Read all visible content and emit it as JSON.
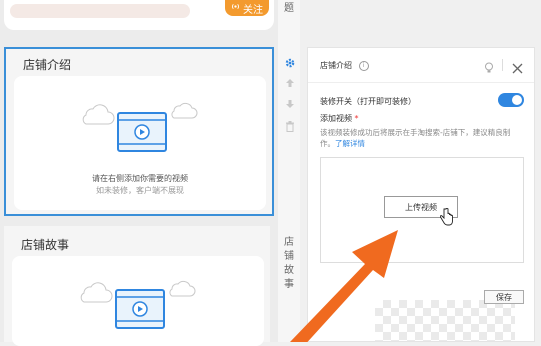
{
  "top_card": {
    "follow_label": "关注"
  },
  "side_tab_top": "题",
  "section1": {
    "title": "店铺介绍",
    "hint_main": "请在右侧添加你需要的视频",
    "hint_sub": "如未装修，客户端不展现"
  },
  "section2": {
    "title": "店铺故事"
  },
  "side_tab_story": [
    "店",
    "铺",
    "故",
    "事"
  ],
  "panel": {
    "title": "店铺介绍",
    "switch_label": "装修开关（打开即可装修）",
    "switch_on": true,
    "add_video_label": "添加视频",
    "required_mark": "*",
    "description": "该视频装修成功后将展示在手淘搜索-店铺下，建议精良制作。",
    "learn_more": "了解详情",
    "upload_label": "上传视频",
    "save_label": "保存"
  },
  "icons": [
    "broadcast-icon",
    "gear-icon",
    "arrow-up-icon",
    "arrow-down-icon",
    "trash-icon",
    "info-icon",
    "lightbulb-icon",
    "close-icon",
    "cloud-icon",
    "video-play-icon",
    "hand-cursor-icon",
    "orange-arrow-icon"
  ],
  "colors": {
    "accent": "#2f86e0",
    "follow": "#f39a2e",
    "arrow": "#f06a1f",
    "selection": "#3a8fd8"
  }
}
